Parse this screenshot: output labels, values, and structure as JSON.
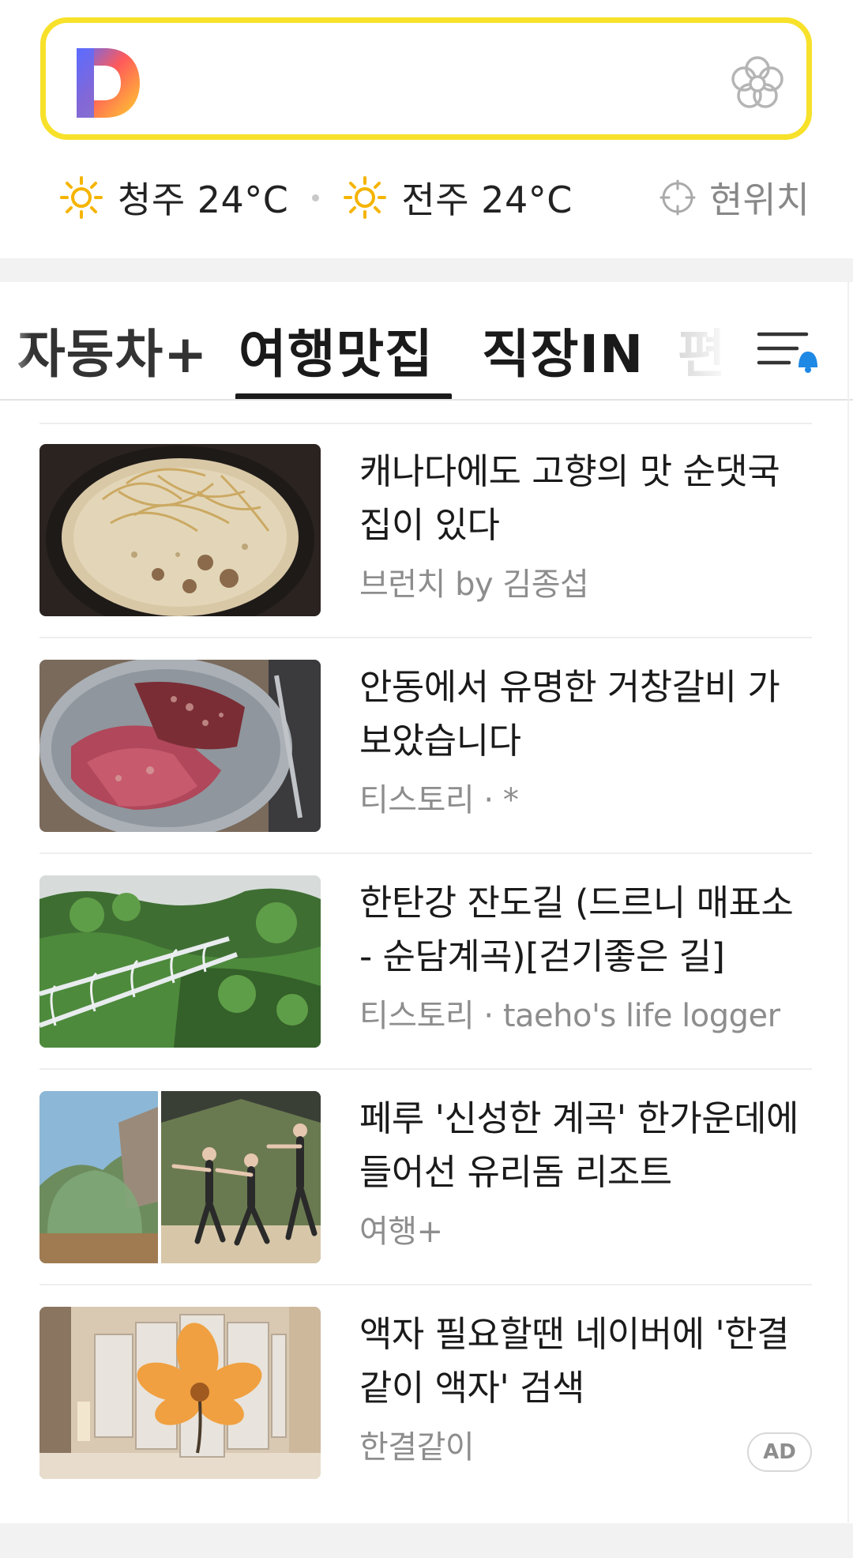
{
  "search": {
    "logo": "D",
    "logo_icon": "daum-d-logo",
    "right_icon": "flower-icon"
  },
  "weather": {
    "items": [
      {
        "city": "청주",
        "temp": "24°C",
        "icon": "sun-icon",
        "label": "청주 24°C"
      },
      {
        "city": "전주",
        "temp": "24°C",
        "icon": "sun-icon",
        "label": "전주 24°C"
      }
    ],
    "location_label": "현위치",
    "location_icon": "crosshair-icon"
  },
  "tabs": {
    "items": [
      {
        "label": "자동차+",
        "active": false
      },
      {
        "label": "여행맛집",
        "active": true
      },
      {
        "label": "직장IN",
        "active": false
      },
      {
        "label": "편",
        "active": false
      }
    ],
    "menu_icon": "menu-bell-icon"
  },
  "articles": [
    {
      "title": "캐나다에도 고향의 맛 순댓국집이 있다",
      "source": "브런치 by 김종섭",
      "thumb": "soup-bowl"
    },
    {
      "title": "안동에서 유명한 거창갈비 가보았습니다",
      "source": "티스토리 · *",
      "thumb": "raw-beef"
    },
    {
      "title": "한탄강 잔도길 (드르니 매표소 - 순담계곡)[걷기좋은 길]",
      "source": "티스토리 · taeho's life logger",
      "thumb": "cliff-walkway"
    },
    {
      "title": "페루 '신성한 계곡' 한가운데에 들어선 유리돔 리조트",
      "source": "여행+",
      "thumb": "glass-dome-yoga"
    },
    {
      "title": "액자 필요할땐 네이버에 '한결같이 액자' 검색",
      "source": "한결같이",
      "thumb": "flower-frame",
      "badge": "AD"
    }
  ],
  "colors": {
    "search_border": "#f7e12a",
    "accent_blue": "#1e88e5",
    "sun": "#f5b400",
    "divider": "#f2f2f2"
  }
}
